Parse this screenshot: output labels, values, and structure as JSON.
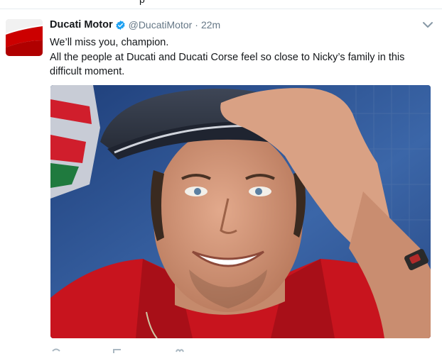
{
  "tweet": {
    "display_name": "Ducati Motor",
    "handle": "@DucatiMotor",
    "separator": "·",
    "time": "22m",
    "text_line_1": "We’ll miss you, champion.",
    "text_line_2": "All the people at Ducati and Ducati Corse feel so close to Nicky’s family in this difficult moment.",
    "verified": true
  },
  "colors": {
    "brand_red": "#cc0000",
    "verified_blue": "#1da1f2",
    "muted_text": "#657786"
  },
  "icons": {
    "verified": "verified-badge-icon",
    "caret": "chevron-down-icon",
    "reply": "reply-icon",
    "retweet": "retweet-icon",
    "like": "heart-icon"
  }
}
